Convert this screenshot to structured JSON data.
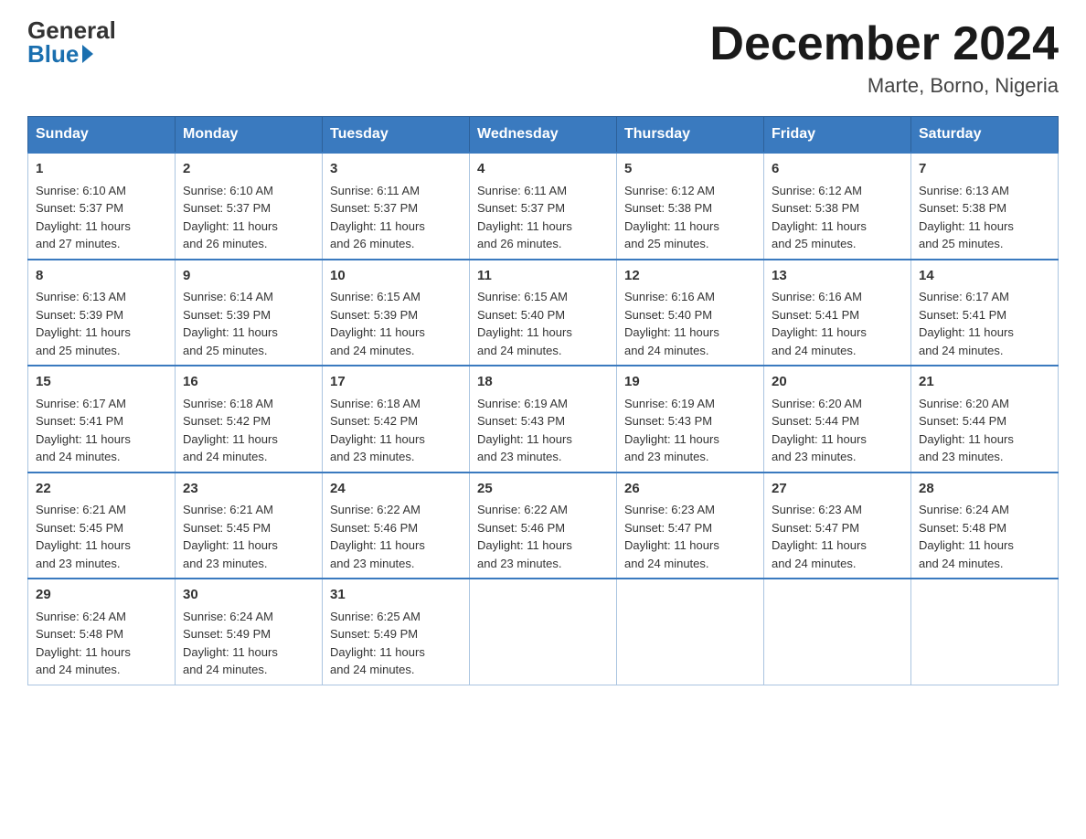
{
  "logo": {
    "general": "General",
    "blue": "Blue"
  },
  "title": "December 2024",
  "subtitle": "Marte, Borno, Nigeria",
  "days_header": [
    "Sunday",
    "Monday",
    "Tuesday",
    "Wednesday",
    "Thursday",
    "Friday",
    "Saturday"
  ],
  "weeks": [
    [
      {
        "day": "1",
        "sunrise": "6:10 AM",
        "sunset": "5:37 PM",
        "daylight": "11 hours and 27 minutes."
      },
      {
        "day": "2",
        "sunrise": "6:10 AM",
        "sunset": "5:37 PM",
        "daylight": "11 hours and 26 minutes."
      },
      {
        "day": "3",
        "sunrise": "6:11 AM",
        "sunset": "5:37 PM",
        "daylight": "11 hours and 26 minutes."
      },
      {
        "day": "4",
        "sunrise": "6:11 AM",
        "sunset": "5:37 PM",
        "daylight": "11 hours and 26 minutes."
      },
      {
        "day": "5",
        "sunrise": "6:12 AM",
        "sunset": "5:38 PM",
        "daylight": "11 hours and 25 minutes."
      },
      {
        "day": "6",
        "sunrise": "6:12 AM",
        "sunset": "5:38 PM",
        "daylight": "11 hours and 25 minutes."
      },
      {
        "day": "7",
        "sunrise": "6:13 AM",
        "sunset": "5:38 PM",
        "daylight": "11 hours and 25 minutes."
      }
    ],
    [
      {
        "day": "8",
        "sunrise": "6:13 AM",
        "sunset": "5:39 PM",
        "daylight": "11 hours and 25 minutes."
      },
      {
        "day": "9",
        "sunrise": "6:14 AM",
        "sunset": "5:39 PM",
        "daylight": "11 hours and 25 minutes."
      },
      {
        "day": "10",
        "sunrise": "6:15 AM",
        "sunset": "5:39 PM",
        "daylight": "11 hours and 24 minutes."
      },
      {
        "day": "11",
        "sunrise": "6:15 AM",
        "sunset": "5:40 PM",
        "daylight": "11 hours and 24 minutes."
      },
      {
        "day": "12",
        "sunrise": "6:16 AM",
        "sunset": "5:40 PM",
        "daylight": "11 hours and 24 minutes."
      },
      {
        "day": "13",
        "sunrise": "6:16 AM",
        "sunset": "5:41 PM",
        "daylight": "11 hours and 24 minutes."
      },
      {
        "day": "14",
        "sunrise": "6:17 AM",
        "sunset": "5:41 PM",
        "daylight": "11 hours and 24 minutes."
      }
    ],
    [
      {
        "day": "15",
        "sunrise": "6:17 AM",
        "sunset": "5:41 PM",
        "daylight": "11 hours and 24 minutes."
      },
      {
        "day": "16",
        "sunrise": "6:18 AM",
        "sunset": "5:42 PM",
        "daylight": "11 hours and 24 minutes."
      },
      {
        "day": "17",
        "sunrise": "6:18 AM",
        "sunset": "5:42 PM",
        "daylight": "11 hours and 23 minutes."
      },
      {
        "day": "18",
        "sunrise": "6:19 AM",
        "sunset": "5:43 PM",
        "daylight": "11 hours and 23 minutes."
      },
      {
        "day": "19",
        "sunrise": "6:19 AM",
        "sunset": "5:43 PM",
        "daylight": "11 hours and 23 minutes."
      },
      {
        "day": "20",
        "sunrise": "6:20 AM",
        "sunset": "5:44 PM",
        "daylight": "11 hours and 23 minutes."
      },
      {
        "day": "21",
        "sunrise": "6:20 AM",
        "sunset": "5:44 PM",
        "daylight": "11 hours and 23 minutes."
      }
    ],
    [
      {
        "day": "22",
        "sunrise": "6:21 AM",
        "sunset": "5:45 PM",
        "daylight": "11 hours and 23 minutes."
      },
      {
        "day": "23",
        "sunrise": "6:21 AM",
        "sunset": "5:45 PM",
        "daylight": "11 hours and 23 minutes."
      },
      {
        "day": "24",
        "sunrise": "6:22 AM",
        "sunset": "5:46 PM",
        "daylight": "11 hours and 23 minutes."
      },
      {
        "day": "25",
        "sunrise": "6:22 AM",
        "sunset": "5:46 PM",
        "daylight": "11 hours and 23 minutes."
      },
      {
        "day": "26",
        "sunrise": "6:23 AM",
        "sunset": "5:47 PM",
        "daylight": "11 hours and 24 minutes."
      },
      {
        "day": "27",
        "sunrise": "6:23 AM",
        "sunset": "5:47 PM",
        "daylight": "11 hours and 24 minutes."
      },
      {
        "day": "28",
        "sunrise": "6:24 AM",
        "sunset": "5:48 PM",
        "daylight": "11 hours and 24 minutes."
      }
    ],
    [
      {
        "day": "29",
        "sunrise": "6:24 AM",
        "sunset": "5:48 PM",
        "daylight": "11 hours and 24 minutes."
      },
      {
        "day": "30",
        "sunrise": "6:24 AM",
        "sunset": "5:49 PM",
        "daylight": "11 hours and 24 minutes."
      },
      {
        "day": "31",
        "sunrise": "6:25 AM",
        "sunset": "5:49 PM",
        "daylight": "11 hours and 24 minutes."
      },
      null,
      null,
      null,
      null
    ]
  ],
  "labels": {
    "sunrise": "Sunrise:",
    "sunset": "Sunset:",
    "daylight": "Daylight:"
  }
}
